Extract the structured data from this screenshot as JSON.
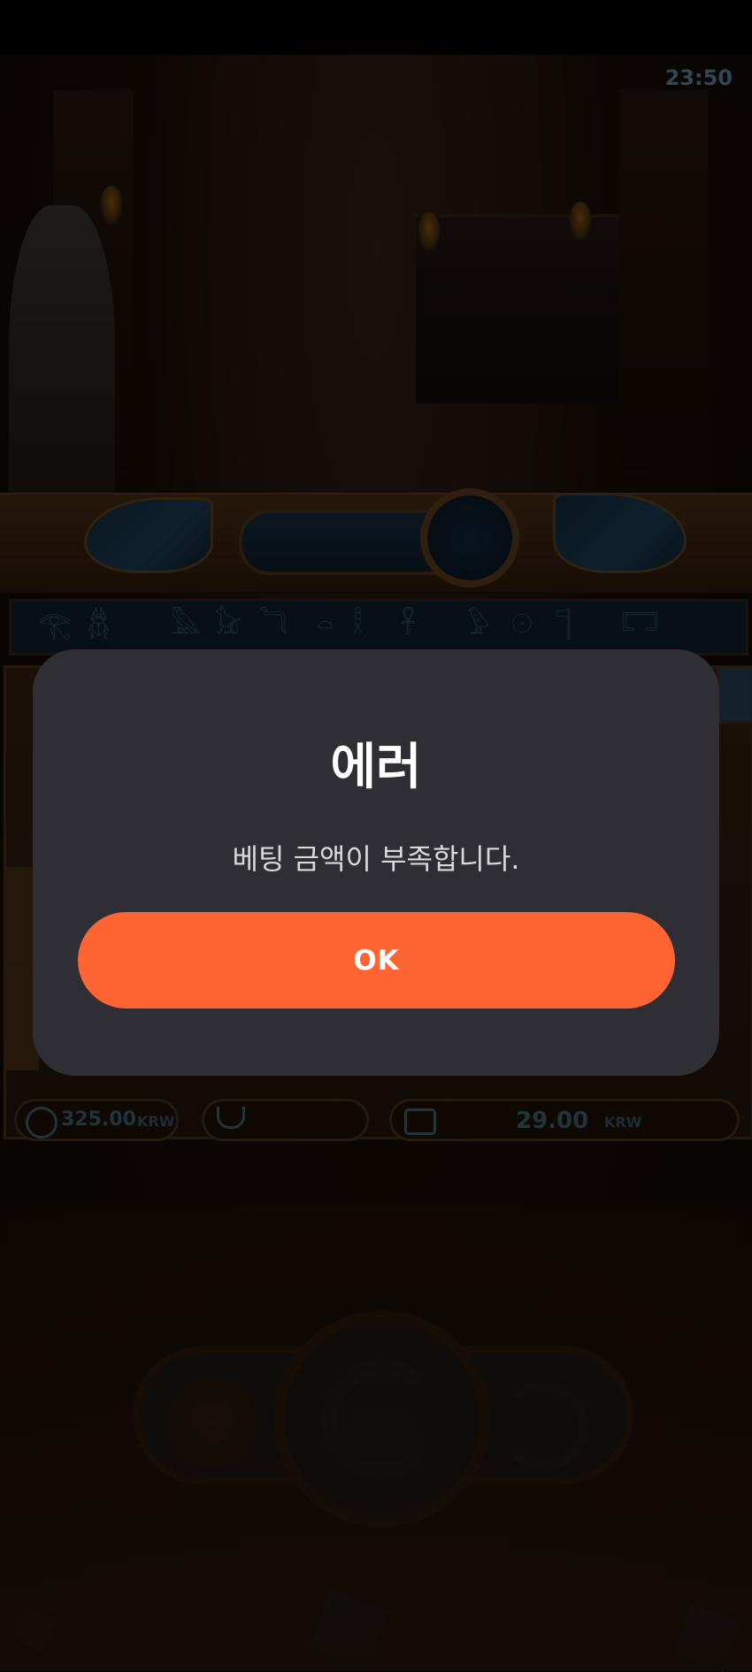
{
  "status_bar": {},
  "game": {
    "clock": "23:50",
    "hieroglyphs": [
      "𓂀",
      "𓆣",
      "𓅓",
      "𓃠",
      "𓆓",
      "𓏏",
      "𓎛",
      "𓋹",
      "𓅱",
      "𓇳",
      "𓊹",
      "𓉐"
    ],
    "hud": {
      "bet_amount": "325.00",
      "bet_currency": "KRW",
      "win_amount": "",
      "balance_amount": "29.00",
      "balance_currency": "KRW"
    }
  },
  "dialog": {
    "title": "에러",
    "message": "베팅 금액이 부족합니다.",
    "ok_label": "OK",
    "ok_color": "#ff6433",
    "background_color": "#2f2e34"
  }
}
